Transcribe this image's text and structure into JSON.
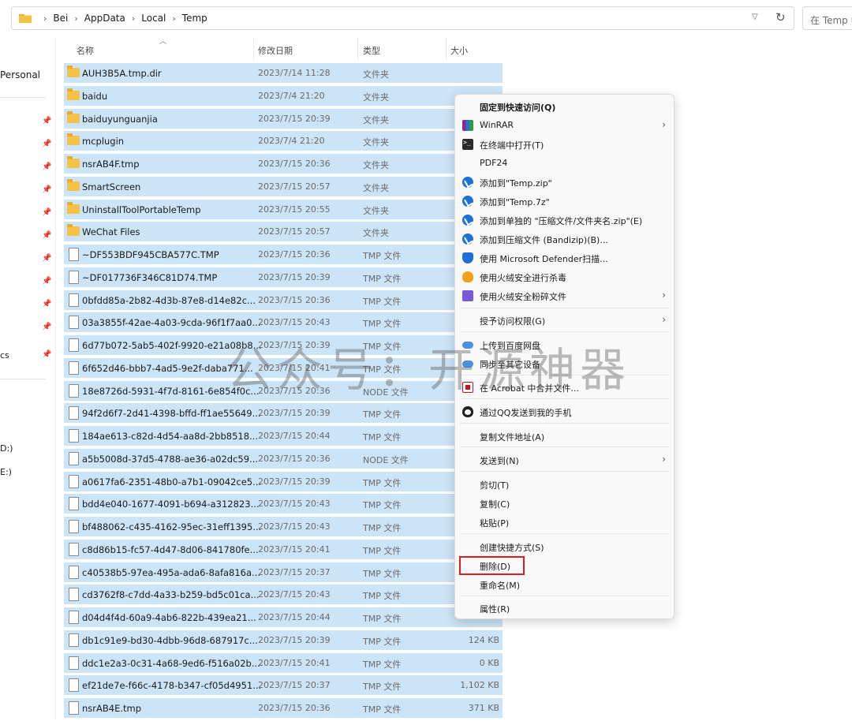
{
  "address_bar": {
    "breadcrumbs": [
      "Bei",
      "AppData",
      "Local",
      "Temp"
    ],
    "search_placeholder": "在 Temp 中"
  },
  "nav": {
    "personal_label": "Personal",
    "partial_label_cs": "cs",
    "drive_d": "D:)",
    "drive_e": "E:)"
  },
  "columns": {
    "name": "名称",
    "date": "修改日期",
    "type": "类型",
    "size": "大小"
  },
  "files": [
    {
      "kind": "folder",
      "name": "AUH3B5A.tmp.dir",
      "date": "2023/7/14 11:28",
      "type": "文件夹",
      "size": ""
    },
    {
      "kind": "folder",
      "name": "baidu",
      "date": "2023/7/4 21:20",
      "type": "文件夹",
      "size": ""
    },
    {
      "kind": "folder",
      "name": "baiduyunguanjia",
      "date": "2023/7/15 20:39",
      "type": "文件夹",
      "size": ""
    },
    {
      "kind": "folder",
      "name": "mcplugin",
      "date": "2023/7/4 21:20",
      "type": "文件夹",
      "size": ""
    },
    {
      "kind": "folder",
      "name": "nsrAB4F.tmp",
      "date": "2023/7/15 20:36",
      "type": "文件夹",
      "size": ""
    },
    {
      "kind": "folder",
      "name": "SmartScreen",
      "date": "2023/7/15 20:57",
      "type": "文件夹",
      "size": ""
    },
    {
      "kind": "folder",
      "name": "UninstallToolPortableTemp",
      "date": "2023/7/15 20:55",
      "type": "文件夹",
      "size": ""
    },
    {
      "kind": "folder",
      "name": "WeChat Files",
      "date": "2023/7/15 20:57",
      "type": "文件夹",
      "size": ""
    },
    {
      "kind": "file",
      "name": "~DF553BDF945CBA577C.TMP",
      "date": "2023/7/15 20:36",
      "type": "TMP 文件",
      "size": ""
    },
    {
      "kind": "file",
      "name": "~DF017736F346C81D74.TMP",
      "date": "2023/7/15 20:39",
      "type": "TMP 文件",
      "size": ""
    },
    {
      "kind": "file",
      "name": "0bfdd85a-2b82-4d3b-87e8-d14e82c...",
      "date": "2023/7/15 20:36",
      "type": "TMP 文件",
      "size": ""
    },
    {
      "kind": "file",
      "name": "03a3855f-42ae-4a03-9cda-96f1f7aa0...",
      "date": "2023/7/15 20:43",
      "type": "TMP 文件",
      "size": ""
    },
    {
      "kind": "file",
      "name": "6d77b072-5ab5-402f-9920-e21a08b8...",
      "date": "2023/7/15 20:39",
      "type": "TMP 文件",
      "size": ""
    },
    {
      "kind": "file",
      "name": "6f652d46-bbb7-4ad5-9e2f-daba771...",
      "date": "2023/7/15 20:41",
      "type": "TMP 文件",
      "size": ""
    },
    {
      "kind": "file",
      "name": "18e8726d-5931-4f7d-8161-6e854f0c...",
      "date": "2023/7/15 20:36",
      "type": "NODE 文件",
      "size": ""
    },
    {
      "kind": "file",
      "name": "94f2d6f7-2d41-4398-bffd-ff1ae55649...",
      "date": "2023/7/15 20:39",
      "type": "TMP 文件",
      "size": ""
    },
    {
      "kind": "file",
      "name": "184ae613-c82d-4d54-aa8d-2bb8518...",
      "date": "2023/7/15 20:44",
      "type": "TMP 文件",
      "size": ""
    },
    {
      "kind": "file",
      "name": "a5b5008d-37d5-4788-ae36-a02dc59...",
      "date": "2023/7/15 20:36",
      "type": "NODE 文件",
      "size": ""
    },
    {
      "kind": "file",
      "name": "a0617fa6-2351-48b0-a7b1-09042ce5...",
      "date": "2023/7/15 20:39",
      "type": "TMP 文件",
      "size": ""
    },
    {
      "kind": "file",
      "name": "bdd4e040-1677-4091-b694-a312823...",
      "date": "2023/7/15 20:43",
      "type": "TMP 文件",
      "size": ""
    },
    {
      "kind": "file",
      "name": "bf488062-c435-4162-95ec-31eff1395...",
      "date": "2023/7/15 20:43",
      "type": "TMP 文件",
      "size": ""
    },
    {
      "kind": "file",
      "name": "c8d86b15-fc57-4d47-8d06-841780fe...",
      "date": "2023/7/15 20:41",
      "type": "TMP 文件",
      "size": ""
    },
    {
      "kind": "file",
      "name": "c40538b5-97ea-495a-ada6-8afa816a...",
      "date": "2023/7/15 20:37",
      "type": "TMP 文件",
      "size": ""
    },
    {
      "kind": "file",
      "name": "cd3762f8-c7dd-4a33-b259-bd5c01ca...",
      "date": "2023/7/15 20:43",
      "type": "TMP 文件",
      "size": ""
    },
    {
      "kind": "file",
      "name": "d04d4f4d-60a9-4ab6-822b-439ea21...",
      "date": "2023/7/15 20:44",
      "type": "TMP 文件",
      "size": ""
    },
    {
      "kind": "file",
      "name": "db1c91e9-bd30-4dbb-96d8-687917c...",
      "date": "2023/7/15 20:39",
      "type": "TMP 文件",
      "size": "124 KB"
    },
    {
      "kind": "file",
      "name": "ddc1e2a3-0c31-4a68-9ed6-f516a02b...",
      "date": "2023/7/15 20:41",
      "type": "TMP 文件",
      "size": "0 KB"
    },
    {
      "kind": "file",
      "name": "ef21de7e-f66c-4178-b347-cf05d4951...",
      "date": "2023/7/15 20:37",
      "type": "TMP 文件",
      "size": "1,102 KB"
    },
    {
      "kind": "file",
      "name": "nsrAB4E.tmp",
      "date": "2023/7/15 20:36",
      "type": "TMP 文件",
      "size": "371 KB"
    }
  ],
  "context_menu": {
    "pin_quick_access": "固定到快速访问(Q)",
    "winrar": "WinRAR",
    "open_terminal": "在终端中打开(T)",
    "pdf24": "PDF24",
    "add_temp_zip": "添加到\"Temp.zip\"",
    "add_temp_7z": "添加到\"Temp.7z\"",
    "add_separate": "添加到单独的 \"压缩文件/文件夹名.zip\"(E)",
    "add_bandizip": "添加到压缩文件 (Bandizip)(B)...",
    "defender_scan": "使用 Microsoft Defender扫描...",
    "huorong_scan": "使用火绒安全进行杀毒",
    "huorong_shred": "使用火绒安全粉碎文件",
    "grant_access": "授予访问权限(G)",
    "upload_baidu": "上传到百度网盘",
    "sync_device": "同步至其它设备",
    "acrobat_merge": "在 Acrobat 中合并文件...",
    "qq_send": "通过QQ发送到我的手机",
    "copy_path": "复制文件地址(A)",
    "send_to": "发送到(N)",
    "cut": "剪切(T)",
    "copy": "复制(C)",
    "paste": "粘贴(P)",
    "create_shortcut": "创建快捷方式(S)",
    "delete": "删除(D)",
    "rename": "重命名(M)",
    "properties": "属性(R)"
  },
  "watermark": "公众号：开源神器",
  "colors": {
    "selection": "#cce4f7",
    "highlight_border": "#e21b1b",
    "folder": "#f4c246"
  }
}
